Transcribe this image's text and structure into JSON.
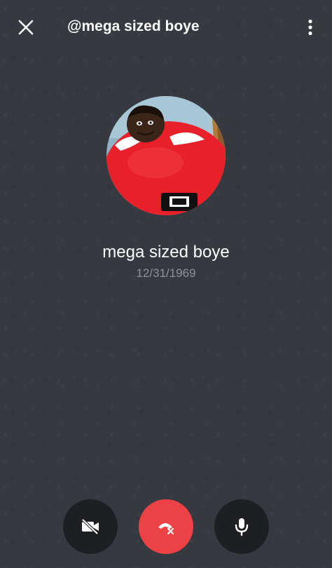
{
  "header": {
    "title": "@mega sized boye",
    "close_icon": "close-icon",
    "more_icon": "more-vertical-icon"
  },
  "profile": {
    "display_name": "mega sized boye",
    "date": "12/31/1969",
    "avatar": "cartoon-avatar"
  },
  "controls": {
    "video_icon": "video-off-icon",
    "end_call_icon": "end-call-icon",
    "mic_icon": "microphone-icon"
  },
  "colors": {
    "background": "#36393f",
    "end_call": "#ed4245",
    "control_button": "#1e1f22",
    "muted_text": "#8e9297"
  }
}
